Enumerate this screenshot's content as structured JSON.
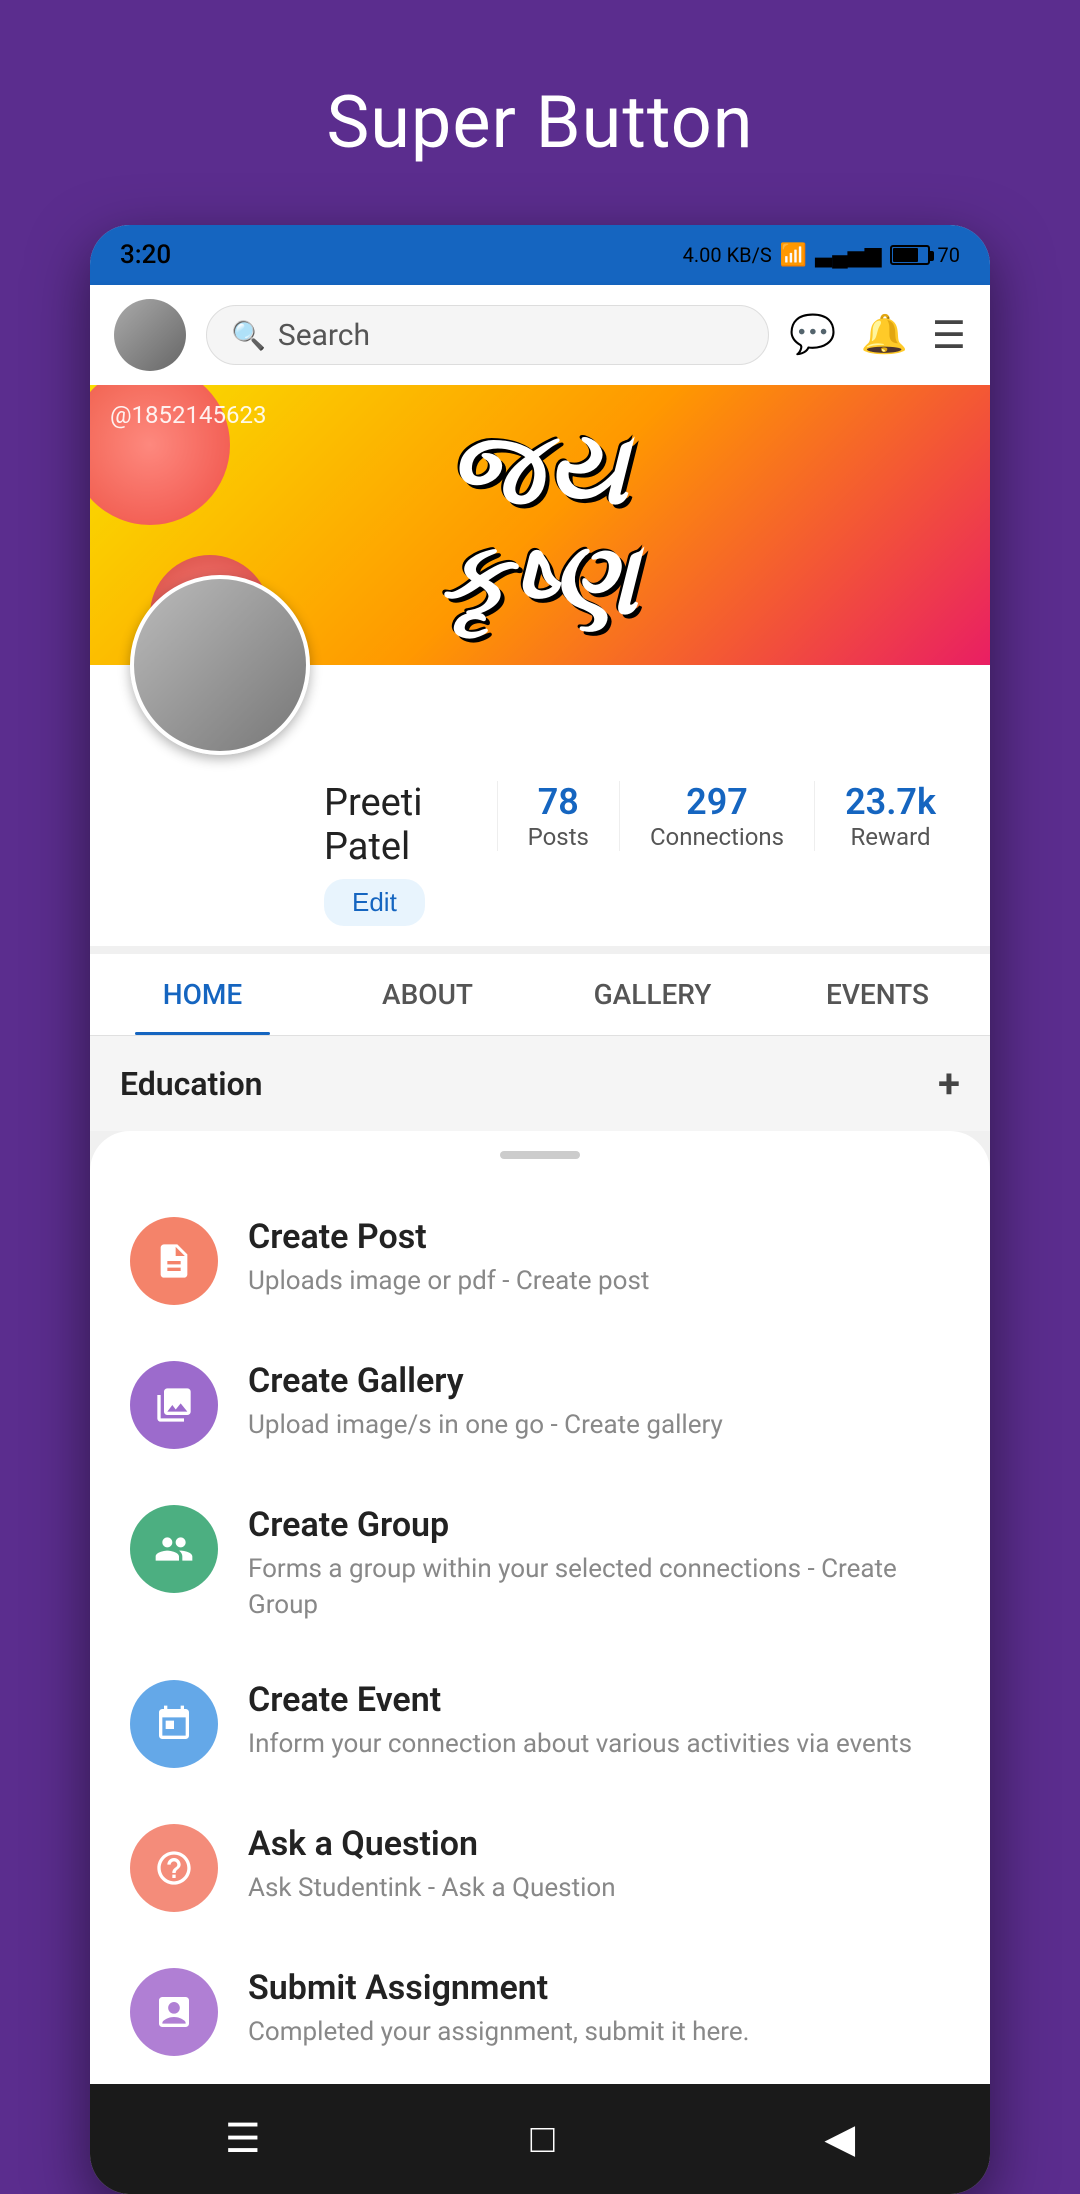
{
  "page": {
    "title": "Super Button",
    "background_color": "#5b2d8e"
  },
  "status_bar": {
    "time": "3:20",
    "data_speed": "4.00 KB/S",
    "battery": "70"
  },
  "app_bar": {
    "search_placeholder": "Search",
    "search_icon": "search-icon",
    "message_icon": "message-icon",
    "notification_icon": "notification-icon",
    "menu_icon": "menu-icon"
  },
  "banner": {
    "username": "@1852145623",
    "text_line1": "જય",
    "text_line2": "કૃષ્ણ"
  },
  "profile": {
    "name": "Preeti Patel",
    "edit_label": "Edit",
    "posts_count": "78",
    "posts_label": "Posts",
    "connections_count": "297",
    "connections_label": "Connections",
    "reward_count": "23.7k",
    "reward_label": "Reward"
  },
  "tabs": [
    {
      "label": "HOME",
      "active": true
    },
    {
      "label": "ABOUT",
      "active": false
    },
    {
      "label": "GALLERY",
      "active": false
    },
    {
      "label": "EVENTS",
      "active": false
    }
  ],
  "education_section": {
    "label": "Education"
  },
  "menu_items": [
    {
      "id": "create-post",
      "icon": "document-icon",
      "icon_class": "icon-post",
      "title": "Create Post",
      "description": "Uploads image or pdf - Create post"
    },
    {
      "id": "create-gallery",
      "icon": "image-icon",
      "icon_class": "icon-gallery",
      "title": "Create Gallery",
      "description": "Upload image/s in one go - Create gallery"
    },
    {
      "id": "create-group",
      "icon": "group-icon",
      "icon_class": "icon-group",
      "title": "Create Group",
      "description": "Forms a group within your selected connections - Create Group"
    },
    {
      "id": "create-event",
      "icon": "calendar-icon",
      "icon_class": "icon-event",
      "title": "Create Event",
      "description": "Inform your connection about various activities via events"
    },
    {
      "id": "ask-question",
      "icon": "question-icon",
      "icon_class": "icon-question",
      "title": "Ask a Question",
      "description": "Ask Studentink - Ask a Question"
    },
    {
      "id": "submit-assignment",
      "icon": "assignment-icon",
      "icon_class": "icon-assignment",
      "title": "Submit Assignment",
      "description": "Completed your assignment, submit it here."
    }
  ],
  "bottom_nav": {
    "menu_icon": "hamburger-icon",
    "home_icon": "square-icon",
    "back_icon": "back-icon"
  }
}
